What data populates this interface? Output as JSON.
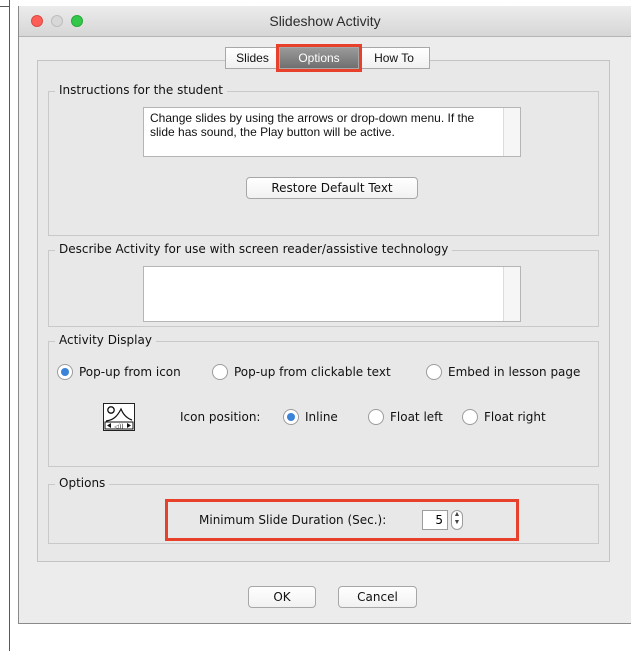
{
  "window": {
    "title": "Slideshow Activity"
  },
  "tabs": [
    {
      "label": "Slides",
      "selected": false
    },
    {
      "label": "Options",
      "selected": true
    },
    {
      "label": "How To",
      "selected": false
    }
  ],
  "instructions": {
    "group_title": "Instructions for the student",
    "text": "Change slides by using the arrows or drop-down menu. If the slide has sound, the Play button will be active.",
    "restore_button": "Restore Default Text"
  },
  "describe": {
    "group_title": "Describe Activity for use with screen reader/assistive technology",
    "text": ""
  },
  "activity_display": {
    "group_title": "Activity Display",
    "modes": [
      {
        "label": "Pop-up from icon",
        "selected": true
      },
      {
        "label": "Pop-up from clickable text",
        "selected": false
      },
      {
        "label": "Embed in lesson page",
        "selected": false
      }
    ],
    "icon_position_label": "Icon position:",
    "positions": [
      {
        "label": "Inline",
        "selected": true
      },
      {
        "label": "Float left",
        "selected": false
      },
      {
        "label": "Float right",
        "selected": false
      }
    ]
  },
  "options": {
    "group_title": "Options",
    "duration_label": "Minimum Slide Duration (Sec.):",
    "duration_value": "5"
  },
  "footer": {
    "ok": "OK",
    "cancel": "Cancel"
  },
  "colors": {
    "highlight": "#e8412b",
    "radio_selected": "#3a83d8"
  },
  "icons": [
    "close-icon",
    "minimize-icon",
    "maximize-icon",
    "slideshow-icon",
    "stepper-icon"
  ]
}
